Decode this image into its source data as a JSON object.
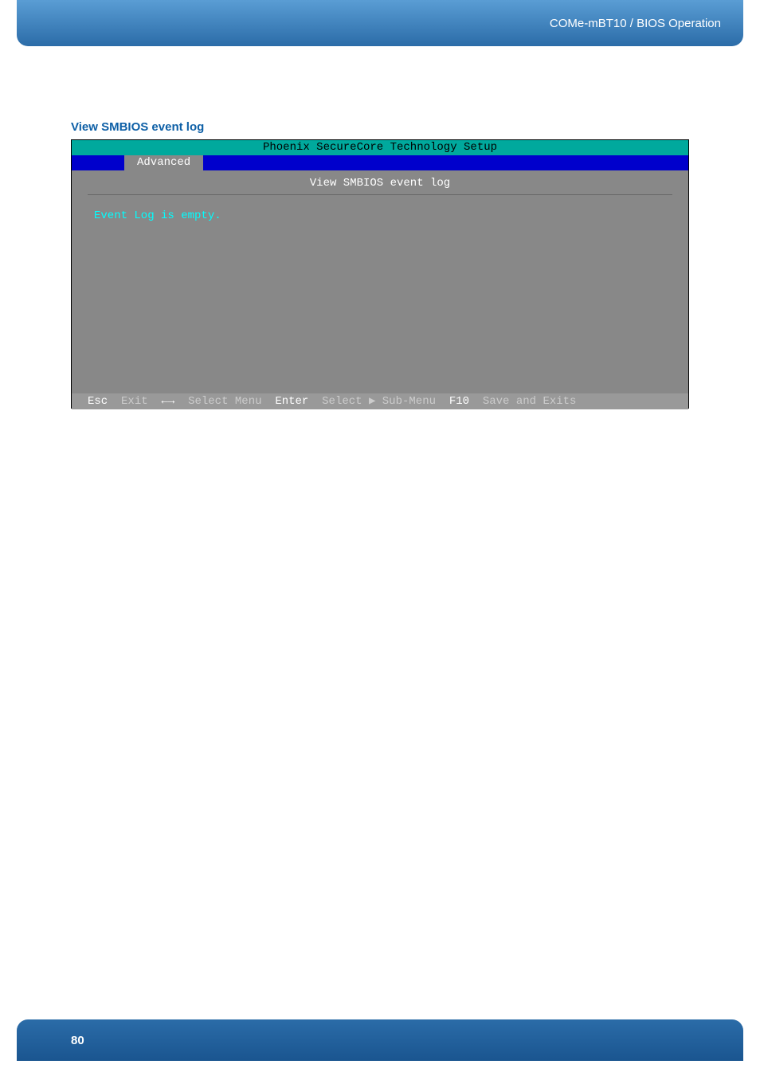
{
  "header": {
    "breadcrumb": "COMe-mBT10 / BIOS Operation"
  },
  "section": {
    "heading": "View SMBIOS event log"
  },
  "bios": {
    "title": "Phoenix SecureCore Technology Setup",
    "active_tab": "Advanced",
    "content_title": "View SMBIOS event log",
    "content_body": "Event Log is empty.",
    "footer_keys": {
      "esc_key": "Esc",
      "esc_action": "Exit",
      "arrows_key": "←→",
      "arrows_action": "Select Menu",
      "enter_key": "Enter",
      "enter_action": "Select ▶ Sub-Menu",
      "f10_key": "F10",
      "f10_action": "Save and Exits"
    }
  },
  "footer": {
    "page_number": "80"
  }
}
